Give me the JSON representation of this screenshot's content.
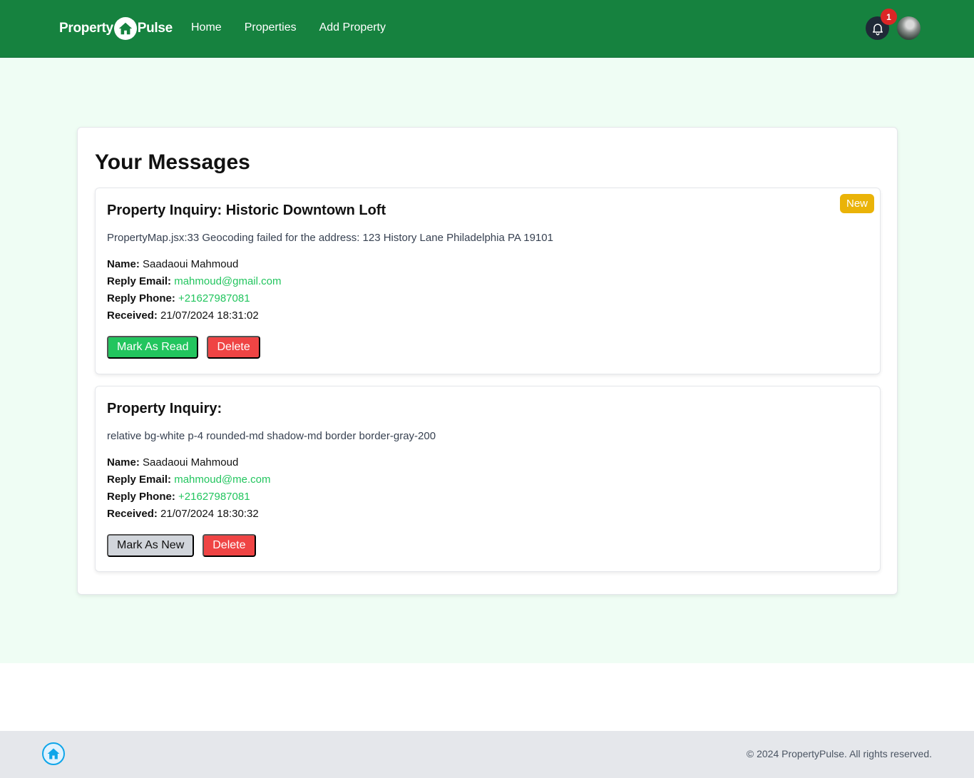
{
  "nav": {
    "brand_left": "Property",
    "brand_right": "Pulse",
    "links": [
      "Home",
      "Properties",
      "Add Property"
    ],
    "notification_count": "1",
    "logo_icon": "house-icon",
    "bell_icon": "bell-icon",
    "brand_color": "#16823f"
  },
  "page": {
    "title": "Your Messages"
  },
  "messages": [
    {
      "title_label": "Property Inquiry:",
      "property_name": "Historic Downtown Loft",
      "badge": "New",
      "body": "PropertyMap.jsx:33 Geocoding failed for the address: 123 History Lane Philadelphia PA 19101",
      "name_label": "Name:",
      "name": "Saadaoui Mahmoud",
      "email_label": "Reply Email:",
      "email": "mahmoud@gmail.com",
      "phone_label": "Reply Phone:",
      "phone": "+21627987081",
      "received_label": "Received:",
      "received": "21/07/2024 18:31:02",
      "toggle_button": "Mark As Read",
      "delete_button": "Delete"
    },
    {
      "title_label": "Property Inquiry:",
      "property_name": "",
      "body": "relative bg-white p-4 rounded-md shadow-md border border-gray-200",
      "name_label": "Name:",
      "name": "Saadaoui Mahmoud",
      "email_label": "Reply Email:",
      "email": "mahmoud@me.com",
      "phone_label": "Reply Phone:",
      "phone": "+21627987081",
      "received_label": "Received:",
      "received": "21/07/2024 18:30:32",
      "toggle_button": "Mark As New",
      "delete_button": "Delete"
    }
  ],
  "footer": {
    "copyright": "© 2024 PropertyPulse. All rights reserved.",
    "logo_icon": "house-icon"
  }
}
